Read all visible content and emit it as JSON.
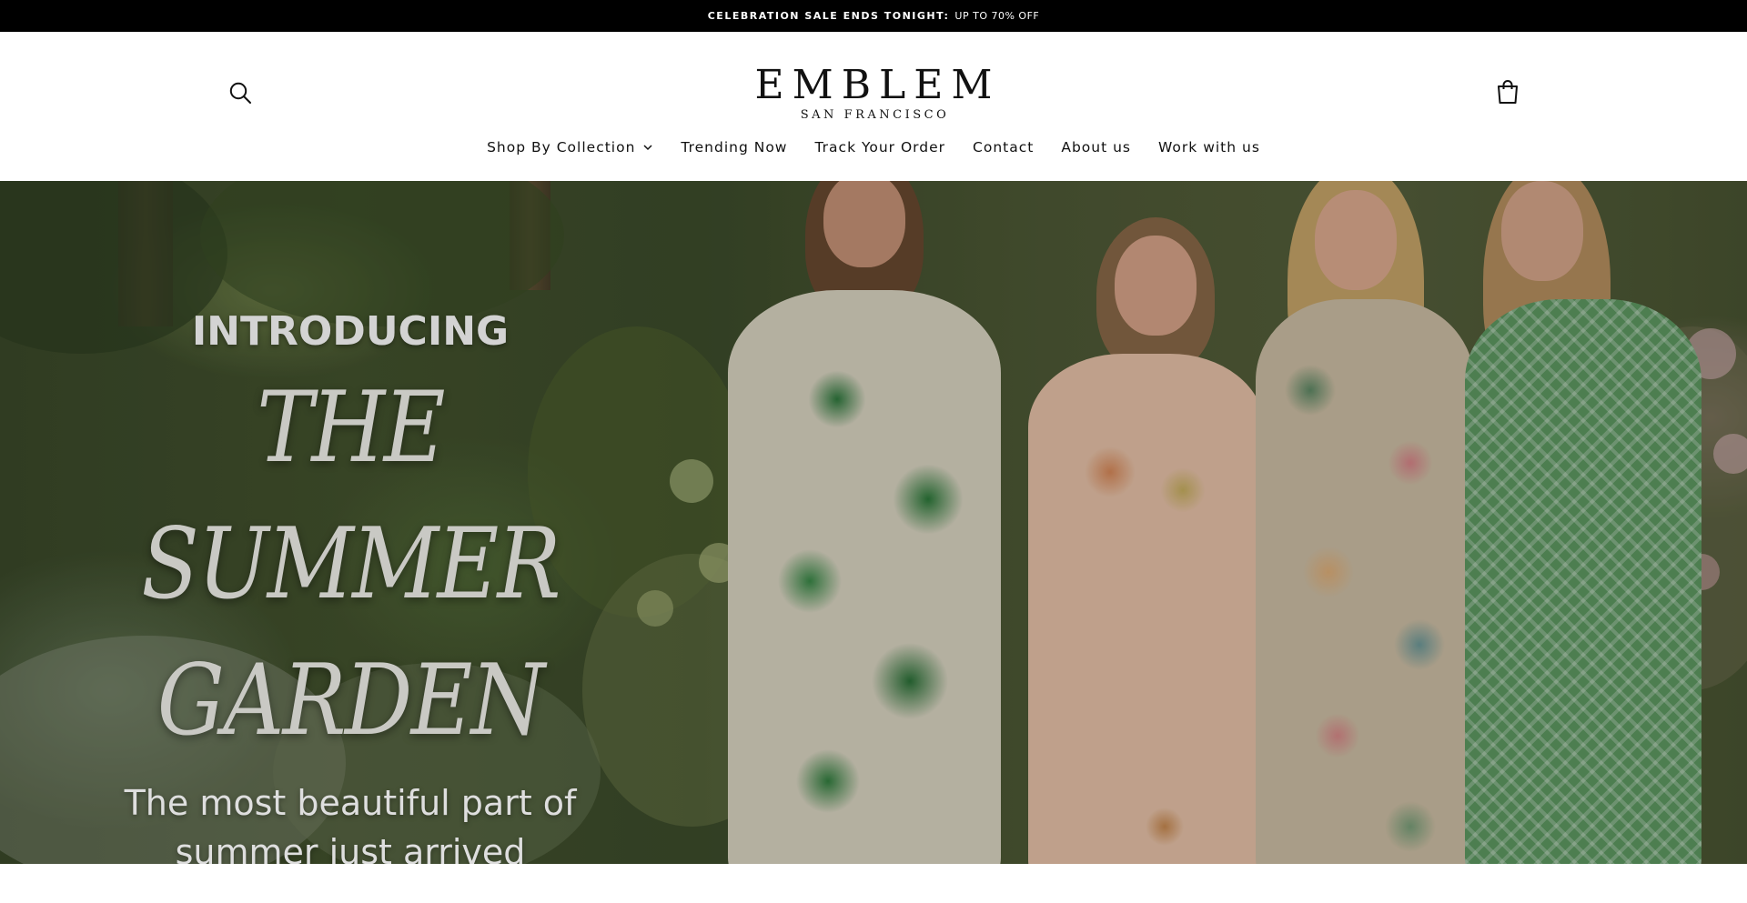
{
  "announcement": {
    "bold_text": "CELEBRATION SALE ENDS TONIGHT:",
    "light_text": "UP TO 70% OFF"
  },
  "header": {
    "logo_main": "EMBLEM",
    "logo_sub": "SAN FRANCISCO",
    "search_icon": "search-icon",
    "cart_icon": "shopping-bag-icon"
  },
  "nav": {
    "items": [
      {
        "label": "Shop By Collection",
        "has_dropdown": true
      },
      {
        "label": "Trending Now"
      },
      {
        "label": "Track Your Order"
      },
      {
        "label": "Contact"
      },
      {
        "label": "About us"
      },
      {
        "label": "Work with us"
      }
    ]
  },
  "hero": {
    "eyebrow": "INTRODUCING",
    "headline_line1": "THE SUMMER",
    "headline_line2": "GARDEN",
    "subcopy_line1": "The most beautiful part of",
    "subcopy_line2": "summer just arrived"
  },
  "colors": {
    "announcement_bg": "#000000",
    "header_bg": "#ffffff",
    "text": "#111111"
  }
}
